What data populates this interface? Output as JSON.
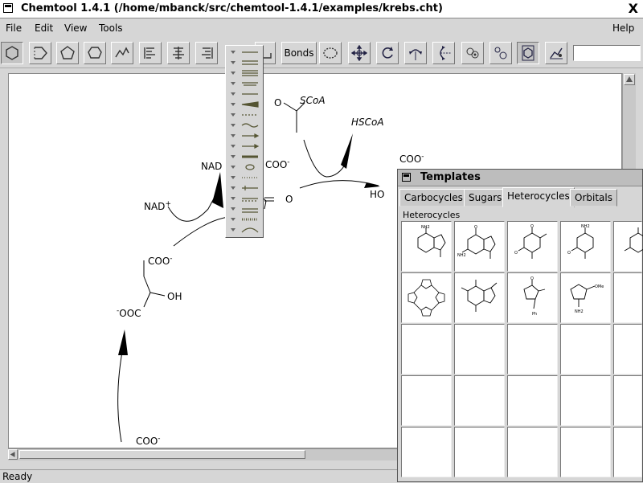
{
  "window": {
    "title": "Chemtool 1.4.1  (/home/mbanck/src/chemtool-1.4.1/examples/krebs.cht)",
    "close_glyph": "X"
  },
  "menubar": {
    "file": "File",
    "edit": "Edit",
    "view": "View",
    "tools": "Tools",
    "help": "Help"
  },
  "toolbar": {
    "bonds_label": "Bonds",
    "text_field_value": ""
  },
  "canvas": {
    "labels": {
      "scoa": "SCoA",
      "o_acetyl": "O",
      "hscoa": "HSCoA",
      "nad_top": "NAD",
      "coo_mid": "COO",
      "o_mid": "O",
      "nad_plus": "NAD",
      "coo_top_right": "COO",
      "ho_right": "HO",
      "coo_malate": "COO",
      "oh_malate": "OH",
      "ooc_malate": "OOC",
      "coo_bottom": "COO"
    },
    "charges": {
      "minus": "-",
      "plus": "+"
    }
  },
  "statusbar": {
    "text": "Ready"
  },
  "templates": {
    "title": "Templates",
    "tabs": [
      "Carbocycles",
      "Sugars",
      "Heterocycles",
      "Orbitals"
    ],
    "active_tab": "Heterocycles",
    "group_label": "Heterocycles",
    "atom_labels": {
      "nh2": "NH2",
      "n": "N",
      "o": "O",
      "h": "H",
      "ph": "Ph",
      "ome": "OMe"
    }
  }
}
